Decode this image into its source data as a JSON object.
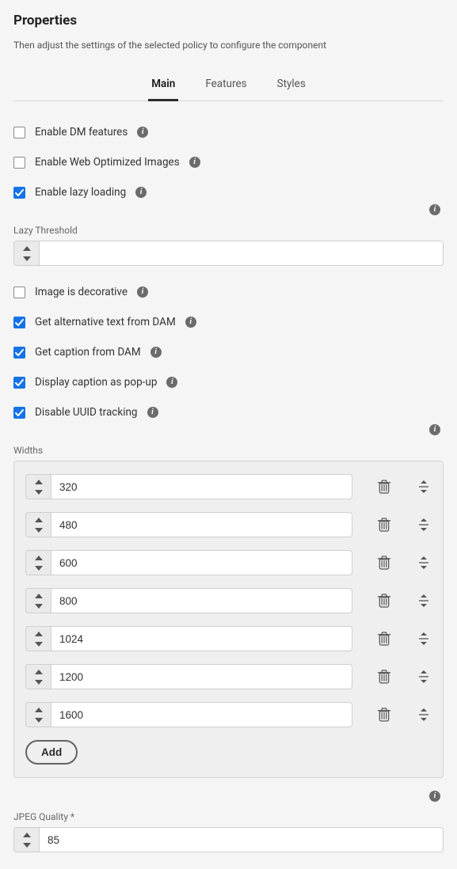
{
  "title": "Properties",
  "subtitle": "Then adjust the settings of the selected policy to configure the component",
  "tabs": {
    "main": "Main",
    "features": "Features",
    "styles": "Styles"
  },
  "checks": {
    "enable_dm": {
      "label": "Enable DM features",
      "checked": false
    },
    "enable_web_opt": {
      "label": "Enable Web Optimized Images",
      "checked": false
    },
    "enable_lazy": {
      "label": "Enable lazy loading",
      "checked": true
    },
    "decorative": {
      "label": "Image is decorative",
      "checked": false
    },
    "alt_from_dam": {
      "label": "Get alternative text from DAM",
      "checked": true
    },
    "caption_from_dam": {
      "label": "Get caption from DAM",
      "checked": true
    },
    "caption_popup": {
      "label": "Display caption as pop-up",
      "checked": true
    },
    "disable_uuid": {
      "label": "Disable UUID tracking",
      "checked": true
    }
  },
  "lazy_threshold": {
    "label": "Lazy Threshold",
    "value": ""
  },
  "widths": {
    "label": "Widths",
    "items": [
      "320",
      "480",
      "600",
      "800",
      "1024",
      "1200",
      "1600"
    ],
    "add_label": "Add"
  },
  "jpeg": {
    "label": "JPEG Quality *",
    "value": "85"
  }
}
